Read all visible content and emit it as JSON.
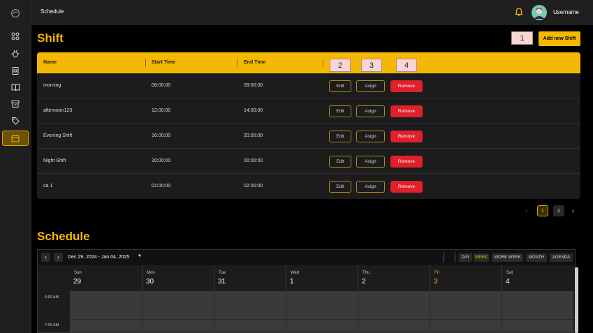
{
  "topbar": {
    "title": "Schedule",
    "username": "Username"
  },
  "sidebar": {
    "items": [
      {
        "icon": "grid-icon"
      },
      {
        "icon": "bug-icon"
      },
      {
        "icon": "clipboard-icon"
      },
      {
        "icon": "book-icon"
      },
      {
        "icon": "archive-icon"
      },
      {
        "icon": "tag-icon"
      },
      {
        "icon": "calendar-icon",
        "active": true
      }
    ]
  },
  "shift": {
    "title": "Shift",
    "add_label": "Add new Shift",
    "columns": [
      "Name",
      "Start Time",
      "End Time"
    ],
    "rows": [
      {
        "name": "morning",
        "start": "08:00:00",
        "end": "09:00:00"
      },
      {
        "name": "afternoon123",
        "start": "12:00:00",
        "end": "14:00:00"
      },
      {
        "name": "Evening Shift",
        "start": "16:00:00",
        "end": "20:00:00"
      },
      {
        "name": "Night Shift",
        "start": "20:00:00",
        "end": "00:00:00"
      },
      {
        "name": "ca 1",
        "start": "01:00:00",
        "end": "02:00:00"
      }
    ],
    "actions": {
      "edit": "Edit",
      "assign": "Asign",
      "remove": "Remove"
    }
  },
  "markers": [
    "1",
    "2",
    "3",
    "4"
  ],
  "pagination": {
    "pages": [
      "1",
      "2"
    ],
    "current": "1"
  },
  "schedule": {
    "title": "Schedule",
    "range": "Dec 29, 2024 - Jan 04, 2025",
    "views": [
      "DAY",
      "WEEK",
      "WORK WEEK",
      "MONTH",
      "AGENDA"
    ],
    "active_view": "WEEK",
    "days": [
      {
        "name": "Sun",
        "num": "29"
      },
      {
        "name": "Mon",
        "num": "30"
      },
      {
        "name": "Tue",
        "num": "31"
      },
      {
        "name": "Wed",
        "num": "1"
      },
      {
        "name": "Thu",
        "num": "2"
      },
      {
        "name": "Fri",
        "num": "3",
        "today": true
      },
      {
        "name": "Sat",
        "num": "4"
      }
    ],
    "times": [
      "6:00 AM",
      "7:00 AM"
    ]
  },
  "colors": {
    "accent": "#f5b800",
    "danger": "#e0202a",
    "bg": "#000000",
    "panel": "#1c1c1c"
  }
}
